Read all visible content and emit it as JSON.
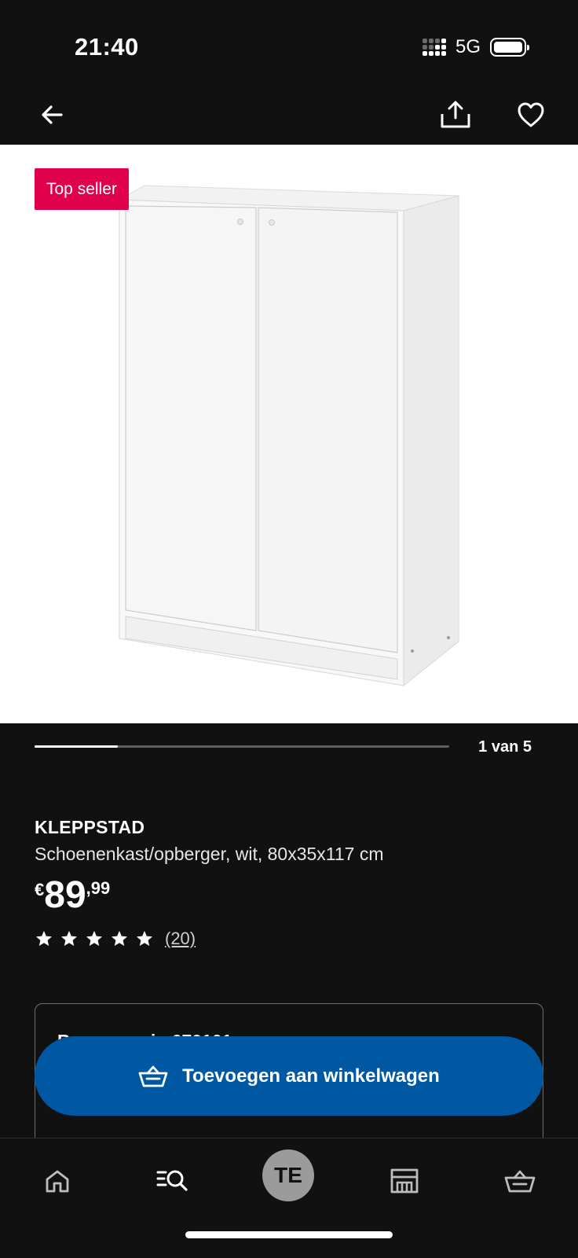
{
  "status_bar": {
    "time": "21:40",
    "network": "5G",
    "icons": [
      "signal-icon",
      "battery-icon"
    ]
  },
  "top_nav": {
    "icons": [
      "arrow-left-icon",
      "share-icon",
      "heart-icon"
    ]
  },
  "product_image": {
    "badge": "Top seller",
    "badge_color": "#e1004c"
  },
  "gallery": {
    "position_label": "1 van 5",
    "current": 1,
    "total": 5
  },
  "product": {
    "name": "KLEPPSTAD",
    "description": "Schoenenkast/opberger, wit, 80x35x117 cm",
    "price": {
      "currency": "€",
      "integer": "89",
      "decimal": ",99"
    },
    "rating": {
      "stars": 5,
      "max": 5,
      "review_count": "(20)"
    }
  },
  "info_card": {
    "text": "Bezorg op in 670101"
  },
  "cart_button": {
    "label": "Toevoegen aan winkelwagen",
    "color": "#0058a3"
  },
  "bottom_nav": {
    "tabs": [
      "home-icon",
      "search-list-icon",
      "avatar",
      "store-icon",
      "basket-icon"
    ],
    "avatar_initials": "TE"
  }
}
